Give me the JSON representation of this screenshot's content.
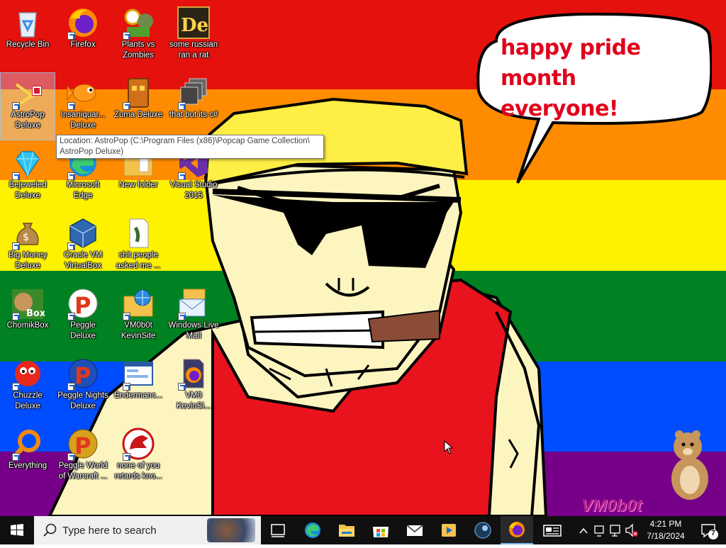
{
  "colors": {
    "red": "#e4110d",
    "orange": "#ff8b00",
    "yellow": "#fff200",
    "green": "#008122",
    "blue": "#004cff",
    "purple": "#760188",
    "taskbar": "#101010",
    "speech_text": "#e0001b"
  },
  "desktop_icons": [
    {
      "label": "Recycle Bin",
      "icon": "recycle-bin-icon"
    },
    {
      "label": "Firefox",
      "icon": "firefox-icon"
    },
    {
      "label": "Plants vs Zombies",
      "icon": "plants-vs-zombies-icon"
    },
    {
      "label": "some russian ran a rat",
      "icon": "de-logo-icon"
    },
    {
      "label": "AstroPop Deluxe",
      "icon": "astropop-icon"
    },
    {
      "label": "Insaniquar... Deluxe",
      "icon": "goldfish-icon"
    },
    {
      "label": "Zuma Deluxe",
      "icon": "zuma-idol-icon"
    },
    {
      "label": "that but its c#",
      "icon": "stacked-windows-icon"
    },
    {
      "label": "Bejeweled Deluxe",
      "icon": "diamond-gem-icon"
    },
    {
      "label": "Microsoft Edge",
      "icon": "edge-icon"
    },
    {
      "label": "New folder",
      "icon": "folder-icon"
    },
    {
      "label": "Visual Studio 2015",
      "icon": "visual-studio-icon"
    },
    {
      "label": "Big Money Deluxe",
      "icon": "money-bag-icon"
    },
    {
      "label": "Oracle VM VirtualBox",
      "icon": "virtualbox-icon"
    },
    {
      "label": "shit people asked me ...",
      "icon": "text-document-icon"
    },
    {
      "label": "ChomikBox",
      "icon": "hamster-box-icon"
    },
    {
      "label": "Peggle Deluxe",
      "icon": "peggle-icon"
    },
    {
      "label": "VM0b0t KevinSite",
      "icon": "web-folder-icon"
    },
    {
      "label": "Windows Live Mail",
      "icon": "live-mail-icon"
    },
    {
      "label": "Chuzzle Deluxe",
      "icon": "chuzzle-icon"
    },
    {
      "label": "Peggle Nights Deluxe",
      "icon": "peggle-nights-icon"
    },
    {
      "label": "Endermanc...",
      "icon": "window-screenshot-icon"
    },
    {
      "label": "VM0 KevinSi...",
      "icon": "firefox-doc-icon"
    },
    {
      "label": "Everything",
      "icon": "search-magnifier-icon"
    },
    {
      "label": "Peggle World of Warcraft ...",
      "icon": "peggle-wow-icon"
    },
    {
      "label": "none of you retards kno...",
      "icon": "red-dragon-icon"
    }
  ],
  "tooltip": "Location: AstroPop (C:\\Program Files (x86)\\Popcap Game Collection\\ AstroPop Deluxe)",
  "speech_bubble": {
    "line1": "happy pride month",
    "line2": "everyone!"
  },
  "watermark": "VM0b0t",
  "taskbar": {
    "search_placeholder": "Type here to search",
    "start_icon": "windows-logo-icon",
    "pinned": [
      "task-view-icon",
      "edge-icon",
      "file-explorer-icon",
      "microsoft-store-icon",
      "mail-icon",
      "media-player-icon",
      "steam-like-icon",
      "firefox-icon",
      "news-icon"
    ],
    "time": "4:21 PM",
    "date": "7/18/2024",
    "notification_count": "7"
  }
}
